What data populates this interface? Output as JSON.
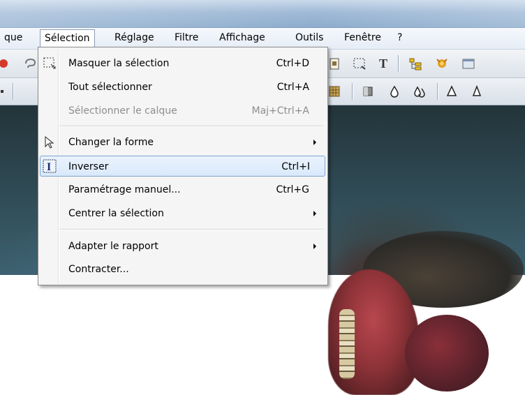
{
  "menubar": {
    "items": [
      {
        "label": "que"
      },
      {
        "label": "Sélection"
      },
      {
        "label": "Réglage"
      },
      {
        "label": "Filtre"
      },
      {
        "label": "Affichage"
      },
      {
        "label": "Outils"
      },
      {
        "label": "Fenêtre"
      },
      {
        "label": "?"
      }
    ]
  },
  "selection_menu": {
    "items": [
      {
        "label": "Masquer la sélection",
        "shortcut": "Ctrl+D",
        "icon": "marquee-selection-icon"
      },
      {
        "label": "Tout sélectionner",
        "shortcut": "Ctrl+A"
      },
      {
        "label": "Sélectionner le calque",
        "shortcut": "Maj+Ctrl+A",
        "disabled": true
      },
      {
        "label": "Changer la forme",
        "submenu": true,
        "icon": "pointer-arrow-icon"
      },
      {
        "label": "Inverser",
        "shortcut": "Ctrl+I",
        "icon": "text-cursor-icon",
        "highlighted": true
      },
      {
        "label": "Paramétrage manuel...",
        "shortcut": "Ctrl+G"
      },
      {
        "label": "Centrer la sélection",
        "submenu": true
      },
      {
        "label": "Adapter le rapport",
        "submenu": true
      },
      {
        "label": "Contracter..."
      }
    ]
  },
  "colors": {
    "highlight_border": "#7da2ce",
    "menu_background": "#f5f5f5",
    "disabled_text": "#8d8d8d"
  }
}
